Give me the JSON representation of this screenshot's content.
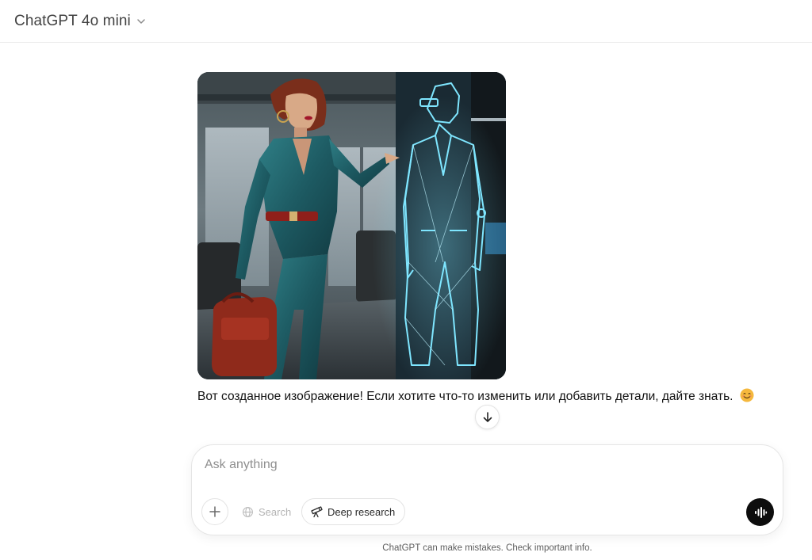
{
  "header": {
    "model_label": "ChatGPT 4o mini",
    "chevron_icon": "chevron-down-icon"
  },
  "conversation": {
    "image_subject": "Generated image: woman in teal suit pointing at holographic wireframe man",
    "assistant_message": "Вот созданное изображение! Если хотите что-то изменить или добавить детали, дайте знать.",
    "emoji_icon": "smiling-face-icon"
  },
  "scroll_button": {
    "icon": "arrow-down-icon"
  },
  "composer": {
    "placeholder": "Ask anything",
    "value": "",
    "attach_icon": "plus-icon",
    "search_label": "Search",
    "search_icon": "globe-icon",
    "deep_research_label": "Deep research",
    "deep_research_icon": "telescope-icon",
    "voice_icon": "voice-mode-icon"
  },
  "footer": {
    "disclaimer": "ChatGPT can make mistakes. Check important info."
  },
  "colors": {
    "background": "#ffffff",
    "voice_button": "#0d0d0d",
    "muted_text": "#8f8f8f",
    "hologram": "#7fe6ff"
  }
}
